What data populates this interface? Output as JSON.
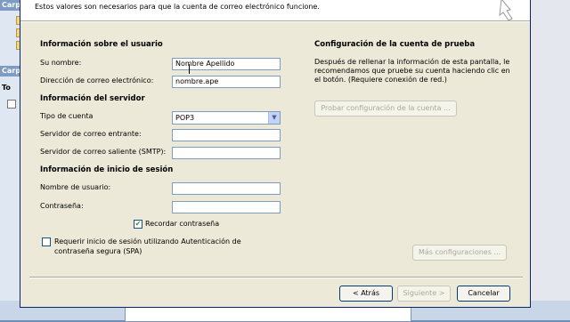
{
  "background": {
    "left_pane_header_1": "Carpe",
    "left_pane_header_2": "Carpe",
    "left_pane_row": "To"
  },
  "dialog": {
    "description": "Estos valores son necesarios para que la cuenta de correo electrónico funcione.",
    "user_info": {
      "heading": "Información sobre el usuario",
      "name_label": "Su nombre:",
      "name_value": "Nombre Apellido",
      "email_label": "Dirección de correo electrónico:",
      "email_value": "nombre.ape"
    },
    "server_info": {
      "heading": "Información del servidor",
      "account_type_label": "Tipo de cuenta",
      "account_type_value": "POP3",
      "incoming_label": "Servidor de correo entrante:",
      "incoming_value": "",
      "outgoing_label": "Servidor de correo saliente (SMTP):",
      "outgoing_value": ""
    },
    "logon_info": {
      "heading": "Información de inicio de sesión",
      "username_label": "Nombre de usuario:",
      "username_value": "",
      "password_label": "Contraseña:",
      "password_value": "",
      "remember_label": "Recordar contraseña",
      "remember_checked": true,
      "spa_label": "Requerir inicio de sesión utilizando Autenticación de contraseña segura (SPA)",
      "spa_checked": false
    },
    "test_settings": {
      "heading": "Configuración de la cuenta de prueba",
      "text": "Después de rellenar la información de esta pantalla, le recomendamos que pruebe su cuenta haciendo clic en el botón. (Requiere conexión de red.)",
      "test_button": "Probar configuración de la cuenta ...",
      "more_button": "Más configuraciones ..."
    },
    "nav": {
      "back": "< Atrás",
      "next": "Siguiente >",
      "cancel": "Cancelar"
    },
    "colors": {
      "dialog_bg": "#ece9d8",
      "check_mark": "#21a121",
      "border_blue": "#0a246a"
    }
  }
}
